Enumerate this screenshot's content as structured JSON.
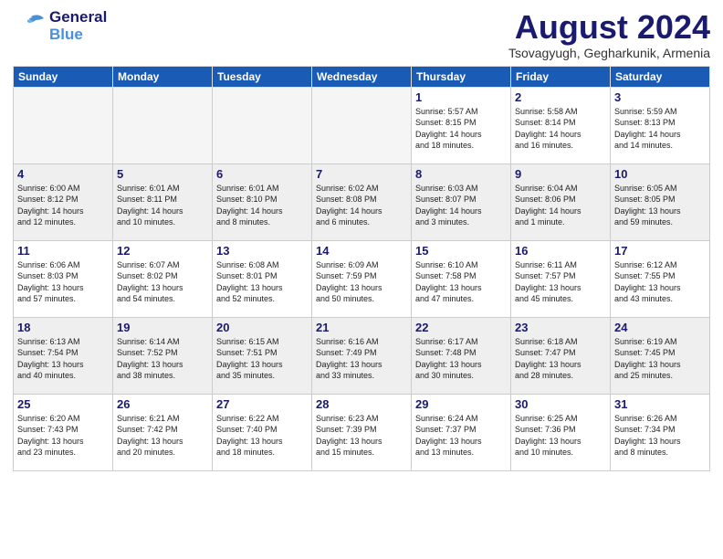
{
  "header": {
    "logo_general": "General",
    "logo_blue": "Blue",
    "month_year": "August 2024",
    "location": "Tsovagyugh, Gegharkunik, Armenia"
  },
  "days_of_week": [
    "Sunday",
    "Monday",
    "Tuesday",
    "Wednesday",
    "Thursday",
    "Friday",
    "Saturday"
  ],
  "weeks": [
    [
      {
        "day": "",
        "info": ""
      },
      {
        "day": "",
        "info": ""
      },
      {
        "day": "",
        "info": ""
      },
      {
        "day": "",
        "info": ""
      },
      {
        "day": "1",
        "info": "Sunrise: 5:57 AM\nSunset: 8:15 PM\nDaylight: 14 hours\nand 18 minutes."
      },
      {
        "day": "2",
        "info": "Sunrise: 5:58 AM\nSunset: 8:14 PM\nDaylight: 14 hours\nand 16 minutes."
      },
      {
        "day": "3",
        "info": "Sunrise: 5:59 AM\nSunset: 8:13 PM\nDaylight: 14 hours\nand 14 minutes."
      }
    ],
    [
      {
        "day": "4",
        "info": "Sunrise: 6:00 AM\nSunset: 8:12 PM\nDaylight: 14 hours\nand 12 minutes."
      },
      {
        "day": "5",
        "info": "Sunrise: 6:01 AM\nSunset: 8:11 PM\nDaylight: 14 hours\nand 10 minutes."
      },
      {
        "day": "6",
        "info": "Sunrise: 6:01 AM\nSunset: 8:10 PM\nDaylight: 14 hours\nand 8 minutes."
      },
      {
        "day": "7",
        "info": "Sunrise: 6:02 AM\nSunset: 8:08 PM\nDaylight: 14 hours\nand 6 minutes."
      },
      {
        "day": "8",
        "info": "Sunrise: 6:03 AM\nSunset: 8:07 PM\nDaylight: 14 hours\nand 3 minutes."
      },
      {
        "day": "9",
        "info": "Sunrise: 6:04 AM\nSunset: 8:06 PM\nDaylight: 14 hours\nand 1 minute."
      },
      {
        "day": "10",
        "info": "Sunrise: 6:05 AM\nSunset: 8:05 PM\nDaylight: 13 hours\nand 59 minutes."
      }
    ],
    [
      {
        "day": "11",
        "info": "Sunrise: 6:06 AM\nSunset: 8:03 PM\nDaylight: 13 hours\nand 57 minutes."
      },
      {
        "day": "12",
        "info": "Sunrise: 6:07 AM\nSunset: 8:02 PM\nDaylight: 13 hours\nand 54 minutes."
      },
      {
        "day": "13",
        "info": "Sunrise: 6:08 AM\nSunset: 8:01 PM\nDaylight: 13 hours\nand 52 minutes."
      },
      {
        "day": "14",
        "info": "Sunrise: 6:09 AM\nSunset: 7:59 PM\nDaylight: 13 hours\nand 50 minutes."
      },
      {
        "day": "15",
        "info": "Sunrise: 6:10 AM\nSunset: 7:58 PM\nDaylight: 13 hours\nand 47 minutes."
      },
      {
        "day": "16",
        "info": "Sunrise: 6:11 AM\nSunset: 7:57 PM\nDaylight: 13 hours\nand 45 minutes."
      },
      {
        "day": "17",
        "info": "Sunrise: 6:12 AM\nSunset: 7:55 PM\nDaylight: 13 hours\nand 43 minutes."
      }
    ],
    [
      {
        "day": "18",
        "info": "Sunrise: 6:13 AM\nSunset: 7:54 PM\nDaylight: 13 hours\nand 40 minutes."
      },
      {
        "day": "19",
        "info": "Sunrise: 6:14 AM\nSunset: 7:52 PM\nDaylight: 13 hours\nand 38 minutes."
      },
      {
        "day": "20",
        "info": "Sunrise: 6:15 AM\nSunset: 7:51 PM\nDaylight: 13 hours\nand 35 minutes."
      },
      {
        "day": "21",
        "info": "Sunrise: 6:16 AM\nSunset: 7:49 PM\nDaylight: 13 hours\nand 33 minutes."
      },
      {
        "day": "22",
        "info": "Sunrise: 6:17 AM\nSunset: 7:48 PM\nDaylight: 13 hours\nand 30 minutes."
      },
      {
        "day": "23",
        "info": "Sunrise: 6:18 AM\nSunset: 7:47 PM\nDaylight: 13 hours\nand 28 minutes."
      },
      {
        "day": "24",
        "info": "Sunrise: 6:19 AM\nSunset: 7:45 PM\nDaylight: 13 hours\nand 25 minutes."
      }
    ],
    [
      {
        "day": "25",
        "info": "Sunrise: 6:20 AM\nSunset: 7:43 PM\nDaylight: 13 hours\nand 23 minutes."
      },
      {
        "day": "26",
        "info": "Sunrise: 6:21 AM\nSunset: 7:42 PM\nDaylight: 13 hours\nand 20 minutes."
      },
      {
        "day": "27",
        "info": "Sunrise: 6:22 AM\nSunset: 7:40 PM\nDaylight: 13 hours\nand 18 minutes."
      },
      {
        "day": "28",
        "info": "Sunrise: 6:23 AM\nSunset: 7:39 PM\nDaylight: 13 hours\nand 15 minutes."
      },
      {
        "day": "29",
        "info": "Sunrise: 6:24 AM\nSunset: 7:37 PM\nDaylight: 13 hours\nand 13 minutes."
      },
      {
        "day": "30",
        "info": "Sunrise: 6:25 AM\nSunset: 7:36 PM\nDaylight: 13 hours\nand 10 minutes."
      },
      {
        "day": "31",
        "info": "Sunrise: 6:26 AM\nSunset: 7:34 PM\nDaylight: 13 hours\nand 8 minutes."
      }
    ]
  ]
}
